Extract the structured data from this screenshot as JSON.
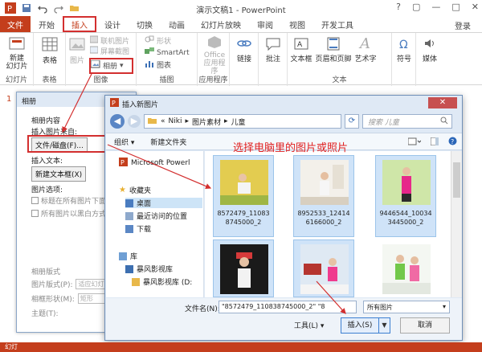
{
  "app": {
    "title": "演示文稿1 - PowerPoint",
    "login": "登录",
    "window_controls": [
      "?",
      "▢",
      "—",
      "□",
      "✕"
    ]
  },
  "tabs": [
    "文件",
    "开始",
    "插入",
    "设计",
    "切换",
    "动画",
    "幻灯片放映",
    "审阅",
    "视图",
    "开发工具"
  ],
  "ribbon": {
    "new_slide": "新建\n幻灯片",
    "table": "表格",
    "picture": "图片",
    "online_picture": "联机图片",
    "screenshot": "屏幕截图",
    "album": "相册",
    "shapes": "形状",
    "smartart": "SmartArt",
    "chart": "图表",
    "office_apps": "Office\n应用程序",
    "link": "链接",
    "comment": "批注",
    "textbox": "文本框",
    "header_footer": "页眉和页脚",
    "wordart": "艺术字",
    "symbol": "符号",
    "media": "媒体",
    "groups": {
      "slides": "幻灯片",
      "tables": "表格",
      "images": "图像",
      "illustrations": "插图",
      "apps": "应用程序",
      "text": "文本"
    }
  },
  "left_panel": {
    "slide_number": "1"
  },
  "status_bar": {
    "text": "幻灯"
  },
  "album_dialog": {
    "title": "相册",
    "content_heading": "相册内容",
    "insert_from": "插入图片来自:",
    "file_button": "文件/磁盘(F)...",
    "insert_text": "插入文本:",
    "new_textbox_button": "新建文本框(X)",
    "picture_options": "图片选项:",
    "caption_option": "标题在所有图片下面",
    "bw_option": "所有图片以黑白方式",
    "layout_heading": "相册版式",
    "layout_label": "图片版式(P):",
    "layout_value": "适应幻灯",
    "frame_label": "相框形状(M):",
    "frame_value": "矩形",
    "theme_label": "主题(T):"
  },
  "insert_dialog": {
    "title": "插入新图片",
    "close": "✕",
    "path": [
      "Niki",
      "图片素材",
      "儿童"
    ],
    "search_placeholder": "搜索 儿童",
    "toolbar": {
      "organize": "组织 ▾",
      "new_folder": "新建文件夹"
    },
    "nav_items": [
      "Microsoft Powerl",
      "收藏夹",
      "桌面",
      "最近访问的位置",
      "下载",
      "库",
      "暴风影视库",
      "暴风影视库 (D:"
    ],
    "files": [
      {
        "name": "8572479_11083\n8745000_2",
        "selected": true
      },
      {
        "name": "8952533_12414\n6166000_2",
        "selected": true
      },
      {
        "name": "9446544_10034\n3445000_2",
        "selected": true
      },
      {
        "name": "",
        "selected": true
      },
      {
        "name": "",
        "selected": true
      },
      {
        "name": "",
        "selected": false
      }
    ],
    "filename_label": "文件名(N):",
    "filename_value": "\"8572479_110838745000_2\" \"8",
    "filetype_value": "所有图片",
    "tools_button": "工具(L)",
    "insert_button": "插入(S)",
    "cancel_button": "取消"
  },
  "annotation": "选择电脑里的图片或照片",
  "colors": {
    "accent": "#c43e1c",
    "highlight_red": "#d32f2f",
    "selection_blue": "#cfe3f8",
    "dialog_bg": "#dfe9f5"
  }
}
